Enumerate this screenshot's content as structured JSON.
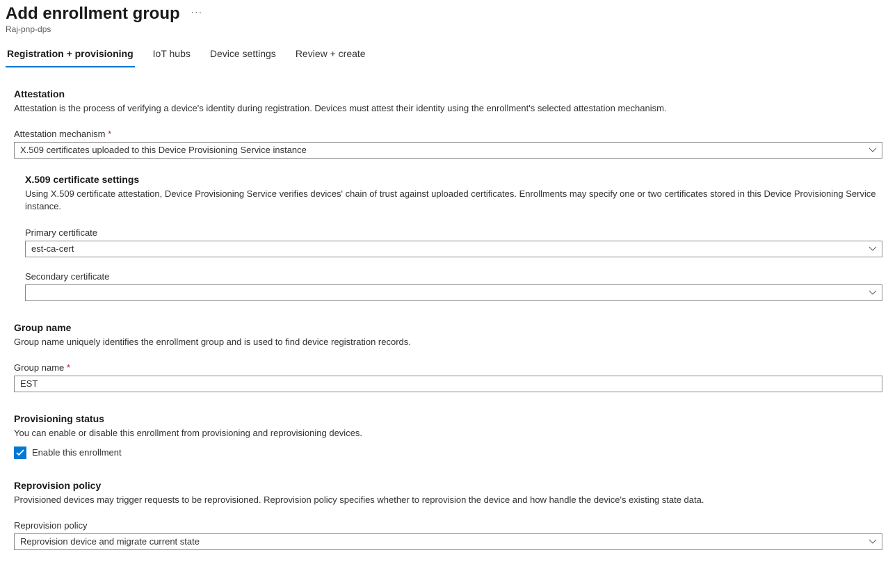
{
  "header": {
    "title": "Add enrollment group",
    "subtitle": "Raj-pnp-dps"
  },
  "tabs": [
    {
      "label": "Registration + provisioning",
      "active": true
    },
    {
      "label": "IoT hubs",
      "active": false
    },
    {
      "label": "Device settings",
      "active": false
    },
    {
      "label": "Review + create",
      "active": false
    }
  ],
  "attestation": {
    "title": "Attestation",
    "desc": "Attestation is the process of verifying a device's identity during registration. Devices must attest their identity using the enrollment's selected attestation mechanism.",
    "mech_label": "Attestation mechanism",
    "mech_value": "X.509 certificates uploaded to this Device Provisioning Service instance"
  },
  "x509": {
    "title": "X.509 certificate settings",
    "desc": "Using X.509 certificate attestation, Device Provisioning Service verifies devices' chain of trust against uploaded certificates. Enrollments may specify one or two certificates stored in this Device Provisioning Service instance.",
    "primary_label": "Primary certificate",
    "primary_value": "est-ca-cert",
    "secondary_label": "Secondary certificate",
    "secondary_value": ""
  },
  "group": {
    "title": "Group name",
    "desc": "Group name uniquely identifies the enrollment group and is used to find device registration records.",
    "label": "Group name",
    "value": "EST"
  },
  "provisioning": {
    "title": "Provisioning status",
    "desc": "You can enable or disable this enrollment from provisioning and reprovisioning devices.",
    "enable_label": "Enable this enrollment",
    "enabled": true
  },
  "reprovision": {
    "title": "Reprovision policy",
    "desc": "Provisioned devices may trigger requests to be reprovisioned. Reprovision policy specifies whether to reprovision the device and how handle the device's existing state data.",
    "label": "Reprovision policy",
    "value": "Reprovision device and migrate current state"
  }
}
